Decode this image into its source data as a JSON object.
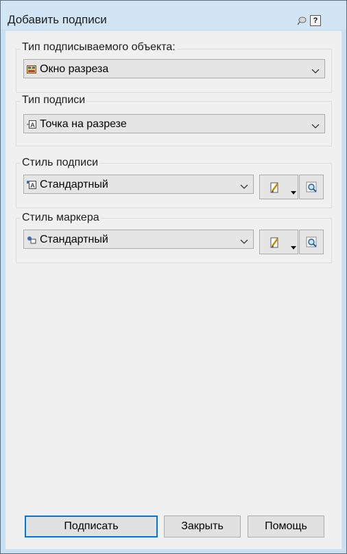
{
  "window": {
    "title": "Добавить подписи"
  },
  "groups": {
    "object_type": {
      "label": "Тип подписываемого объекта:",
      "value": "Окно разреза",
      "icon": "section-view-icon"
    },
    "label_type": {
      "label": "Тип подписи",
      "value": "Точка на разрезе",
      "icon": "label-a-icon"
    },
    "label_style": {
      "label": "Стиль подписи",
      "value": "Стандартный",
      "icon": "label-style-icon"
    },
    "marker_style": {
      "label": "Стиль маркера",
      "value": "Стандартный",
      "icon": "marker-style-icon"
    }
  },
  "buttons": {
    "label": "Подписать",
    "close": "Закрыть",
    "help": "Помощь"
  },
  "colors": {
    "title_bar": "#d2e5f5",
    "client_bg": "#f0f0f0",
    "default_button_border": "#0078d7"
  }
}
